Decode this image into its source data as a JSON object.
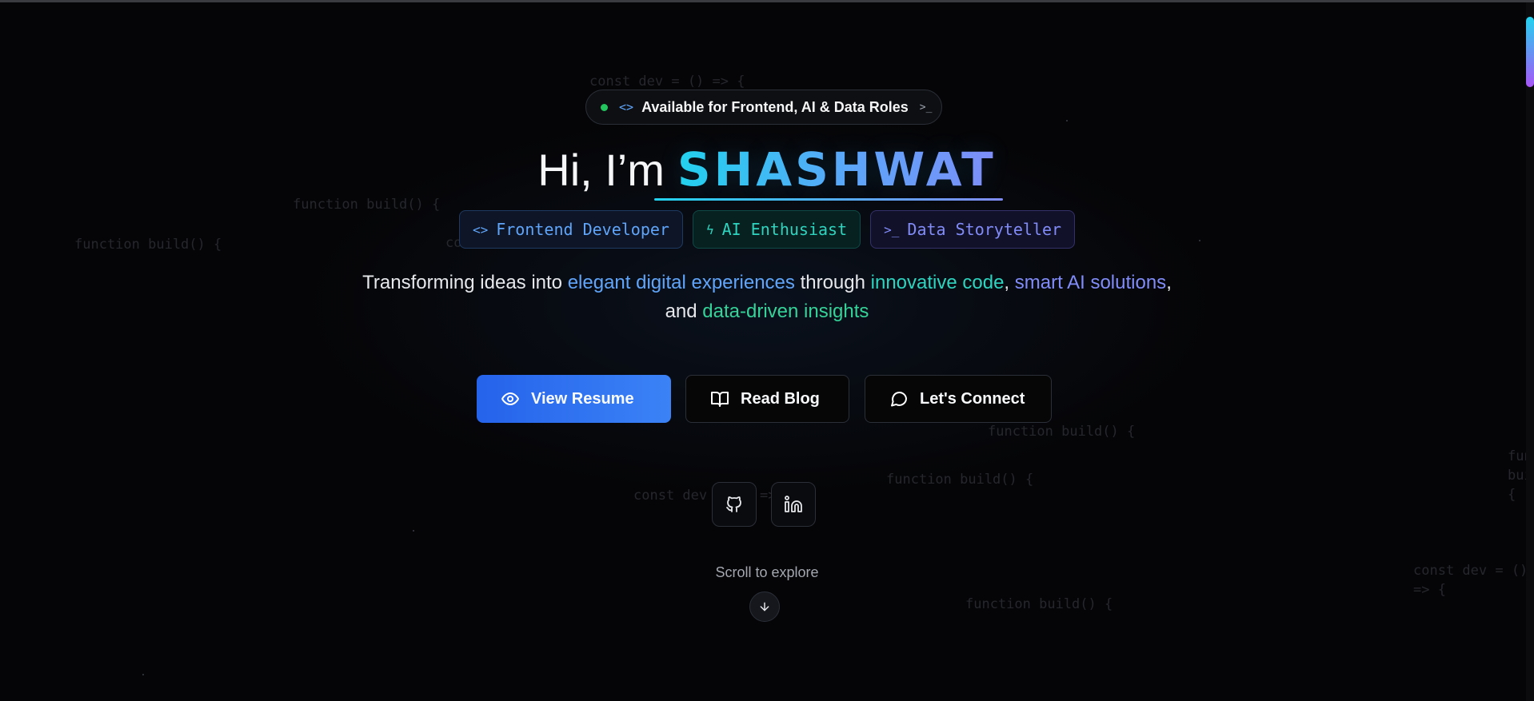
{
  "background_code": [
    "const dev = () => {",
    "function build() {",
    "function build() {",
    "const",
    "function build() {",
    "const dev",
    "=>",
    "function build() {",
    "fun\nbui\n{",
    "const dev = ()\n=> {",
    "function build() {"
  ],
  "badge": {
    "text": "Available for Frontend, AI & Data Roles",
    "code_icon": "<>",
    "terminal_icon": ">_",
    "status_color": "#22c55e"
  },
  "hero": {
    "greeting": "Hi, I’m",
    "name": "SHASHWAT"
  },
  "roles": [
    {
      "icon": "code-icon",
      "glyph": "<>",
      "label": "Frontend Developer",
      "color": "#60a5fa"
    },
    {
      "icon": "bolt-icon",
      "glyph": "ϟ",
      "label": "AI Enthusiast",
      "color": "#2dd4bf"
    },
    {
      "icon": "terminal-icon",
      "glyph": ">_",
      "label": "Data Storyteller",
      "color": "#818cf8"
    }
  ],
  "tagline": {
    "part1": "Transforming ideas into ",
    "hl1": "elegant digital experiences",
    "part2": " through ",
    "hl2": "innovative code",
    "part3": ", ",
    "hl3": "smart AI solutions",
    "part4": ",",
    "part5": "and ",
    "hl4": "data-driven insights"
  },
  "buttons": {
    "resume": "View Resume",
    "blog": "Read Blog",
    "connect": "Let's Connect"
  },
  "social": {
    "github": "github-icon",
    "linkedin": "linkedin-icon"
  },
  "scroll": {
    "label": "Scroll to explore"
  },
  "colors": {
    "accent_blue": "#3b82f6",
    "accent_cyan": "#22d3ee",
    "accent_indigo": "#818cf8",
    "accent_green": "#34d399",
    "background": "#050507"
  }
}
